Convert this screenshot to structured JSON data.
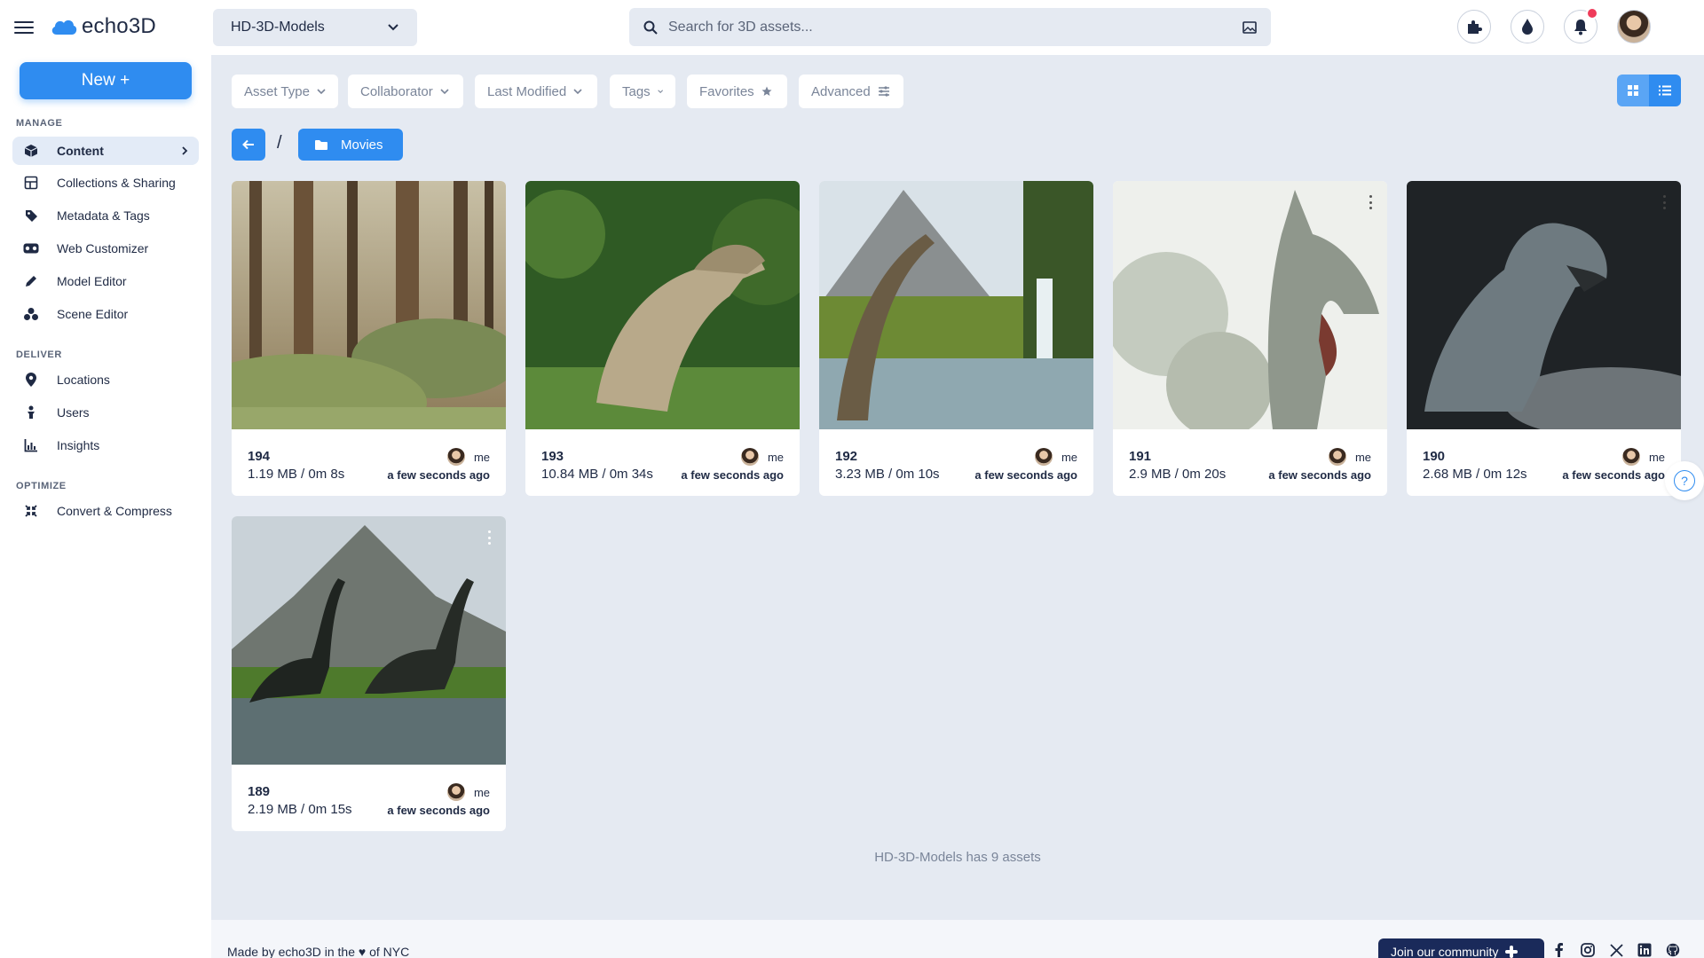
{
  "app": {
    "name": "echo3D"
  },
  "header": {
    "project": "HD-3D-Models",
    "search_placeholder": "Search for 3D assets..."
  },
  "sidebar": {
    "new_label": "New +",
    "sections": {
      "manage": "MANAGE",
      "deliver": "DELIVER",
      "optimize": "OPTIMIZE"
    },
    "items": [
      {
        "label": "Content",
        "icon": "cube-icon",
        "active": true
      },
      {
        "label": "Collections & Sharing",
        "icon": "grid-icon"
      },
      {
        "label": "Metadata & Tags",
        "icon": "tag-icon"
      },
      {
        "label": "Web Customizer",
        "icon": "vr-headset-icon"
      },
      {
        "label": "Model Editor",
        "icon": "pencil-icon"
      },
      {
        "label": "Scene Editor",
        "icon": "shapes-icon"
      },
      {
        "label": "Locations",
        "icon": "pin-icon"
      },
      {
        "label": "Users",
        "icon": "user-icon"
      },
      {
        "label": "Insights",
        "icon": "chart-icon"
      },
      {
        "label": "Convert & Compress",
        "icon": "compress-icon"
      }
    ]
  },
  "filters": [
    {
      "label": "Asset Type"
    },
    {
      "label": "Collaborator"
    },
    {
      "label": "Last Modified"
    },
    {
      "label": "Tags"
    },
    {
      "label": "Favorites"
    },
    {
      "label": "Advanced"
    }
  ],
  "breadcrumb": {
    "separator": "/",
    "folder": "Movies"
  },
  "assets": [
    {
      "name": "194",
      "meta": "1.19 MB / 0m 8s",
      "owner": "me",
      "time": "a few seconds ago"
    },
    {
      "name": "193",
      "meta": "10.84 MB / 0m 34s",
      "owner": "me",
      "time": "a few seconds ago"
    },
    {
      "name": "192",
      "meta": "3.23 MB / 0m 10s",
      "owner": "me",
      "time": "a few seconds ago"
    },
    {
      "name": "191",
      "meta": "2.9 MB / 0m 20s",
      "owner": "me",
      "time": "a few seconds ago"
    },
    {
      "name": "190",
      "meta": "2.68 MB / 0m 12s",
      "owner": "me",
      "time": "a few seconds ago"
    },
    {
      "name": "189",
      "meta": "2.19 MB / 0m 15s",
      "owner": "me",
      "time": "a few seconds ago"
    }
  ],
  "asset_count": "HD-3D-Models has 9 assets",
  "footer": {
    "made_by": "Made by echo3D in the ♥ of NYC",
    "community": "Join our community"
  },
  "colors": {
    "accent": "#2f8cf0",
    "notification": "#ef3b5a",
    "community_bg": "#1a2a5a"
  }
}
